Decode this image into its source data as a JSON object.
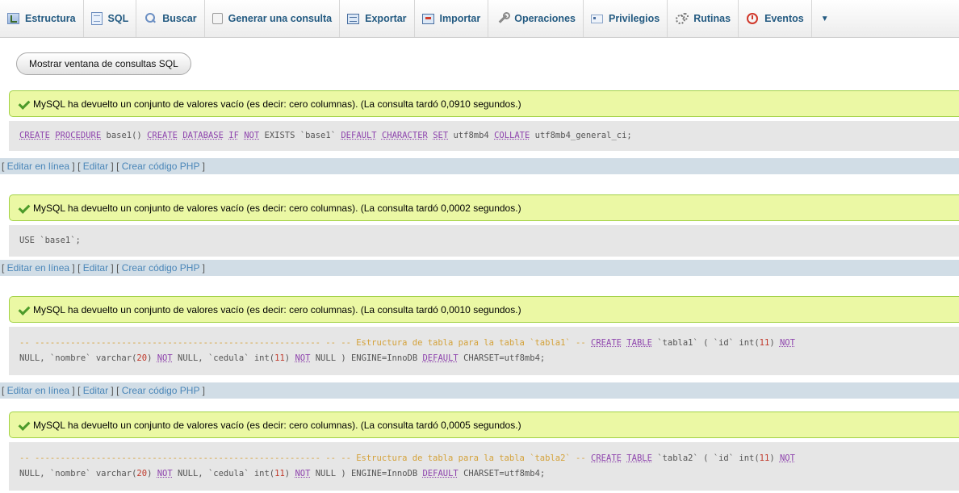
{
  "tabs": [
    {
      "label": "Estructura",
      "icon": "structure-icon"
    },
    {
      "label": "SQL",
      "icon": "sql-icon"
    },
    {
      "label": "Buscar",
      "icon": "search-icon"
    },
    {
      "label": "Generar una consulta",
      "icon": "query-builder-icon"
    },
    {
      "label": "Exportar",
      "icon": "export-icon"
    },
    {
      "label": "Importar",
      "icon": "import-icon"
    },
    {
      "label": "Operaciones",
      "icon": "wrench-icon"
    },
    {
      "label": "Privilegios",
      "icon": "privileges-icon"
    },
    {
      "label": "Rutinas",
      "icon": "routines-icon"
    },
    {
      "label": "Eventos",
      "icon": "events-icon"
    }
  ],
  "toolbar": {
    "show_sql_window": "Mostrar ventana de consultas SQL"
  },
  "results": [
    {
      "message": "MySQL ha devuelto un conjunto de valores vacío (es decir: cero columnas). (La consulta tardó 0,0910 segundos.)",
      "query_lines": [
        [
          [
            "kw",
            "CREATE"
          ],
          [
            "t",
            " "
          ],
          [
            "kw",
            "PROCEDURE"
          ],
          [
            "t",
            " base1() "
          ],
          [
            "kw",
            "CREATE"
          ],
          [
            "t",
            " "
          ],
          [
            "kw",
            "DATABASE"
          ],
          [
            "t",
            " "
          ],
          [
            "kw",
            "IF"
          ],
          [
            "t",
            " "
          ],
          [
            "kw",
            "NOT"
          ],
          [
            "t",
            " EXISTS `base1` "
          ],
          [
            "kw",
            "DEFAULT"
          ],
          [
            "t",
            " "
          ],
          [
            "kw",
            "CHARACTER"
          ],
          [
            "t",
            " "
          ],
          [
            "kw",
            "SET"
          ],
          [
            "t",
            " utf8mb4 "
          ],
          [
            "kw",
            "COLLATE"
          ],
          [
            "t",
            " utf8mb4_general_ci;"
          ]
        ]
      ]
    },
    {
      "message": "MySQL ha devuelto un conjunto de valores vacío (es decir: cero columnas). (La consulta tardó 0,0002 segundos.)",
      "query_lines": [
        [
          [
            "t",
            "USE `base1`;"
          ]
        ]
      ]
    },
    {
      "message": "MySQL ha devuelto un conjunto de valores vacío (es decir: cero columnas). (La consulta tardó 0,0010 segundos.)",
      "query_lines": [
        [
          [
            "cmt",
            "-- -------------------------------------------------------- -- -- Estructura de tabla para la tabla `tabla1` --"
          ],
          [
            "t",
            " "
          ],
          [
            "kw",
            "CREATE"
          ],
          [
            "t",
            " "
          ],
          [
            "kw",
            "TABLE"
          ],
          [
            "t",
            " `tabla1` ( `id` int("
          ],
          [
            "num",
            "11"
          ],
          [
            "t",
            ") "
          ],
          [
            "kw",
            "NOT"
          ]
        ],
        [
          [
            "t",
            "NULL, `nombre` varchar("
          ],
          [
            "num",
            "20"
          ],
          [
            "t",
            ") "
          ],
          [
            "kw",
            "NOT"
          ],
          [
            "t",
            " NULL, `cedula` int("
          ],
          [
            "num",
            "11"
          ],
          [
            "t",
            ") "
          ],
          [
            "kw",
            "NOT"
          ],
          [
            "t",
            " NULL ) ENGINE=InnoDB "
          ],
          [
            "kw",
            "DEFAULT"
          ],
          [
            "t",
            " CHARSET=utf8mb4;"
          ]
        ]
      ]
    },
    {
      "message": "MySQL ha devuelto un conjunto de valores vacío (es decir: cero columnas). (La consulta tardó 0,0005 segundos.)",
      "query_lines": [
        [
          [
            "cmt",
            "-- -------------------------------------------------------- -- -- Estructura de tabla para la tabla `tabla2` --"
          ],
          [
            "t",
            " "
          ],
          [
            "kw",
            "CREATE"
          ],
          [
            "t",
            " "
          ],
          [
            "kw",
            "TABLE"
          ],
          [
            "t",
            " `tabla2` ( `id` int("
          ],
          [
            "num",
            "11"
          ],
          [
            "t",
            ") "
          ],
          [
            "kw",
            "NOT"
          ]
        ],
        [
          [
            "t",
            "NULL, `nombre` varchar("
          ],
          [
            "num",
            "20"
          ],
          [
            "t",
            ") "
          ],
          [
            "kw",
            "NOT"
          ],
          [
            "t",
            " NULL, `cedula` int("
          ],
          [
            "num",
            "11"
          ],
          [
            "t",
            ") "
          ],
          [
            "kw",
            "NOT"
          ],
          [
            "t",
            " NULL ) ENGINE=InnoDB "
          ],
          [
            "kw",
            "DEFAULT"
          ],
          [
            "t",
            " CHARSET=utf8mb4;"
          ]
        ]
      ]
    }
  ],
  "links": {
    "edit_inline": "Editar en línea",
    "edit": "Editar",
    "create_php": "Crear código PHP"
  }
}
